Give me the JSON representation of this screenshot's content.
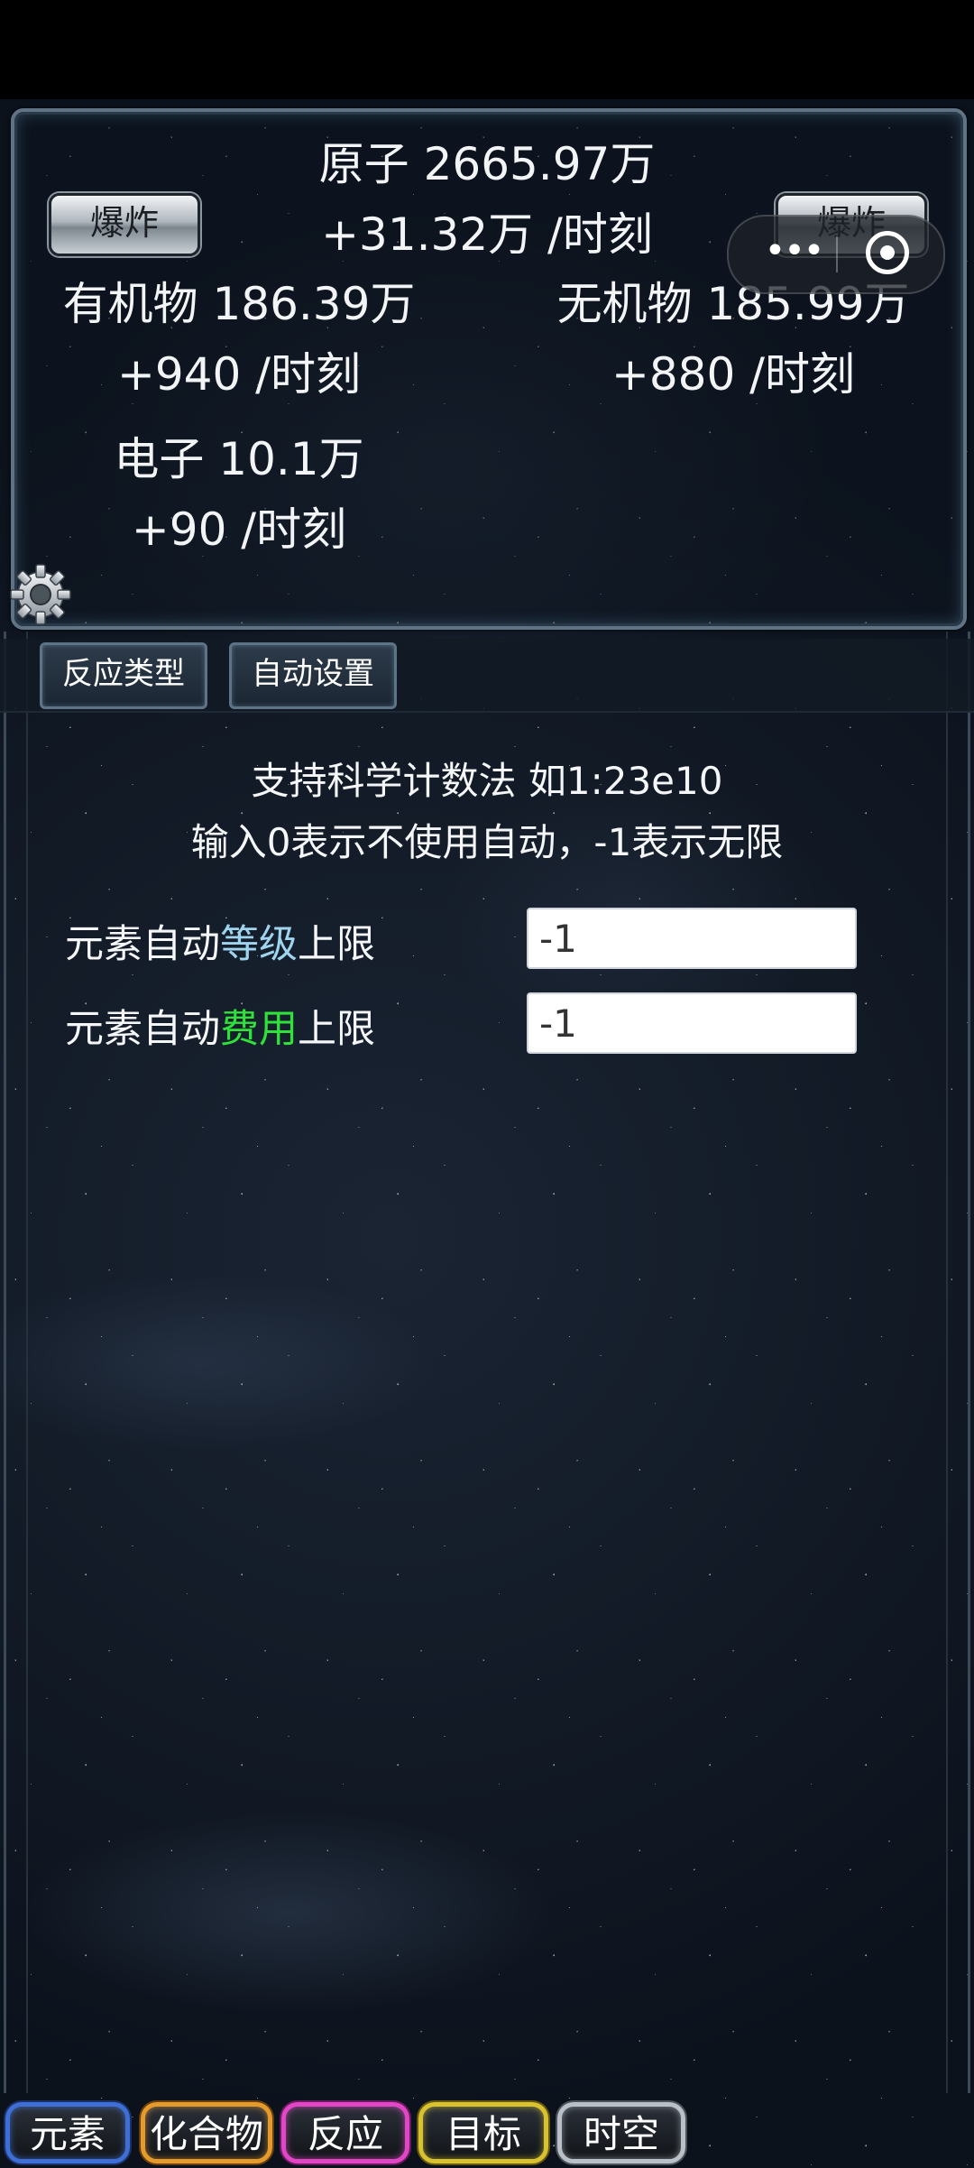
{
  "resources": {
    "atom": {
      "name_value": "原子 2665.97万",
      "rate": "+31.32万 /时刻"
    },
    "organic": {
      "name_value": "有机物 186.39万",
      "rate": "+940 /时刻"
    },
    "inorganic": {
      "name_value": "无机物 185.99万",
      "rate": "+880 /时刻"
    },
    "electron": {
      "name_value": "电子 10.1万",
      "rate": "+90 /时刻"
    }
  },
  "explode_left_label": "爆炸",
  "explode_right_label": "爆炸",
  "capsule": {
    "more": "•••",
    "close_icon": "target-circle-icon"
  },
  "tabs": {
    "reaction_type": "反应类型",
    "auto_settings": "自动设置"
  },
  "info": {
    "line1": "支持科学计数法 如1:23e10",
    "line2": "输入0表示不使用自动，-1表示无限"
  },
  "settings": {
    "level_prefix": "元素自动",
    "level_highlight": "等级",
    "level_suffix": "上限",
    "level_value": "-1",
    "cost_prefix": "元素自动",
    "cost_highlight": "费用",
    "cost_suffix": "上限",
    "cost_value": "-1"
  },
  "bottom_nav": {
    "elements": "元素",
    "compounds": "化合物",
    "reaction": "反应",
    "goals": "目标",
    "spacetime": "时空"
  },
  "colors": {
    "highlight_blue": "#9fd4ee",
    "highlight_green": "#2ee23a",
    "nav_blue": "#3d6fd6",
    "nav_orange": "#e59a2c",
    "nav_pink": "#e046c6",
    "nav_yellow": "#d8c230",
    "nav_silver": "#b9c0c7"
  }
}
